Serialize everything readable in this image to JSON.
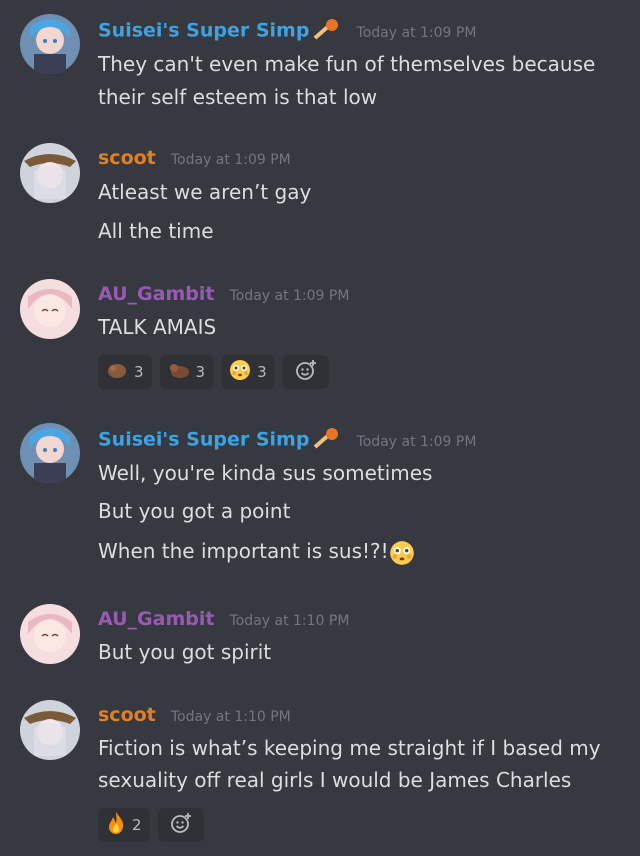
{
  "colors": {
    "background": "#36393f",
    "suisei": "#3ea3e5",
    "scoot": "#e67e22",
    "gambit": "#9b59b6",
    "timestamp": "#72767d",
    "text": "#dcddde"
  },
  "messages": [
    {
      "author": "Suisei's Super Simp",
      "timestamp": "Today at 1:09 PM",
      "lines": [
        "They can't even make fun of themselves because",
        "their self esteem is that low"
      ]
    },
    {
      "author": "scoot",
      "timestamp": "Today at 1:09 PM",
      "lines": [
        "Atleast we aren’t gay",
        "All the time"
      ]
    },
    {
      "author": "AU_Gambit",
      "timestamp": "Today at 1:09 PM",
      "lines": [
        "TALK AMAIS"
      ],
      "reactions": [
        {
          "icon": "custom-emoji-1",
          "count": "3"
        },
        {
          "icon": "custom-emoji-2",
          "count": "3"
        },
        {
          "icon": "flushed-face-emoji",
          "count": "3"
        }
      ]
    },
    {
      "author": "Suisei's Super Simp",
      "timestamp": "Today at 1:09 PM",
      "lines": [
        "Well, you're kinda sus sometimes",
        "But you got a point",
        "When the important is sus!?!"
      ]
    },
    {
      "author": "AU_Gambit",
      "timestamp": "Today at 1:10 PM",
      "lines": [
        "But you got spirit"
      ]
    },
    {
      "author": "scoot",
      "timestamp": "Today at 1:10 PM",
      "lines": [
        "Fiction is what’s keeping me straight if I based my",
        "sexuality off real girls I would be James Charles"
      ],
      "reactions": [
        {
          "icon": "fire-emoji",
          "count": "2"
        }
      ]
    }
  ]
}
